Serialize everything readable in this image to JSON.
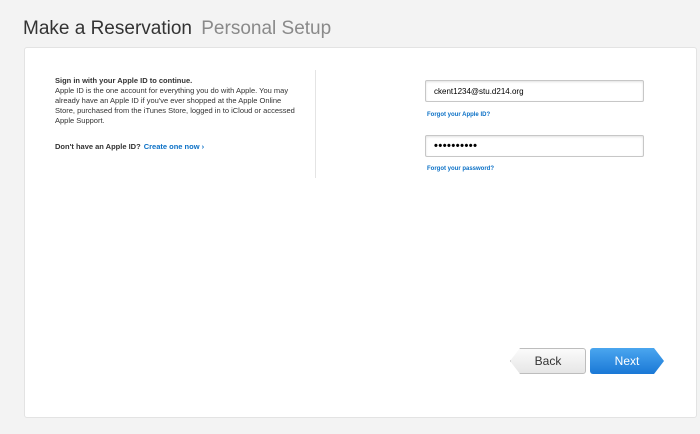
{
  "page": {
    "title": "Make a Reservation",
    "subtitle": "Personal Setup"
  },
  "signin": {
    "heading": "Sign in with your Apple ID to continue.",
    "description": "Apple ID is the one account for everything you do with Apple. You may already have an Apple ID if you've ever shopped at the Apple Online Store, purchased from the iTunes Store, logged in to iCloud or accessed Apple Support.",
    "no_account_question": "Don't have an Apple ID?",
    "create_link": "Create one now ›"
  },
  "form": {
    "apple_id_value": "ckent1234@stu.d214.org",
    "forgot_id_link": "Forgot your Apple ID?",
    "password_value": "••••••••••",
    "forgot_password_link": "Forgot your password?"
  },
  "actions": {
    "back_label": "Back",
    "next_label": "Next"
  },
  "colors": {
    "link": "#0a70c6",
    "primary_button": "#2b8be3",
    "background": "#f3f3f3"
  }
}
